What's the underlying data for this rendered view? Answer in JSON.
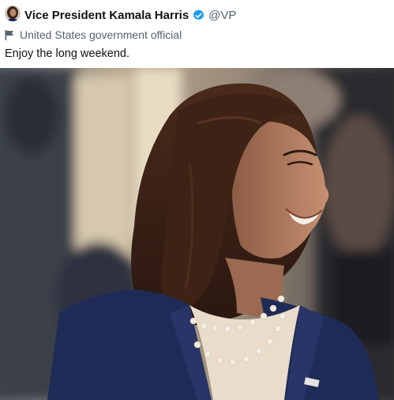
{
  "tweet": {
    "author": {
      "display_name": "Vice President Kamala Harris",
      "handle": "@VP",
      "verified": true,
      "avatar": "profile-photo"
    },
    "label": {
      "icon": "flag-icon",
      "text": "United States government official"
    },
    "text": "Enjoy the long weekend.",
    "media": {
      "type": "photo",
      "icon": "smiling-woman-portrait"
    }
  },
  "colors": {
    "primary_text": "#0f1419",
    "secondary_text": "#536471",
    "verified_badge": "#1d9bf0",
    "blazer": "#1f2b57"
  }
}
